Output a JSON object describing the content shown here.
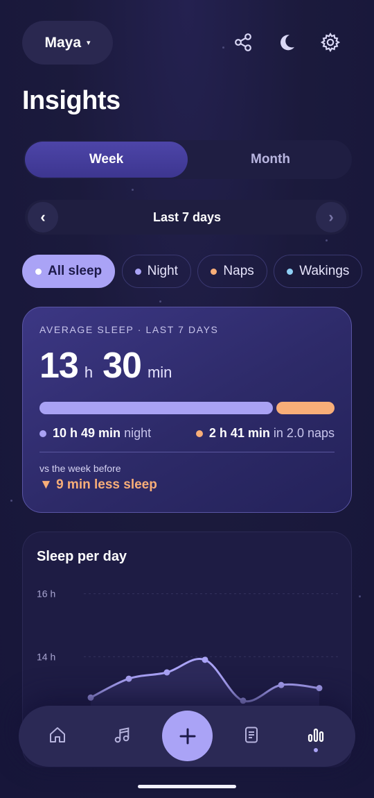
{
  "header": {
    "profile_name": "Maya",
    "profile_caret": "▾",
    "icons": [
      "share-icon",
      "moon-icon",
      "gear-icon"
    ]
  },
  "page": {
    "title": "Insights"
  },
  "range_tabs": [
    {
      "label": "Week",
      "active": true
    },
    {
      "label": "Month",
      "active": false
    }
  ],
  "date_nav": {
    "prev": "‹",
    "label": "Last 7 days",
    "next": "›"
  },
  "filters": [
    {
      "label": "All sleep",
      "active": true,
      "dot_color": "#ffffff"
    },
    {
      "label": "Night",
      "active": false,
      "dot_color": "#aaa3f6"
    },
    {
      "label": "Naps",
      "active": false,
      "dot_color": "#f8ae78"
    },
    {
      "label": "Wakings",
      "active": false,
      "dot_color": "#8fd0f5"
    }
  ],
  "average": {
    "caption": "AVERAGE SLEEP · LAST 7 DAYS",
    "hours": "13",
    "hours_unit": "h",
    "minutes": "30",
    "minutes_unit": "min",
    "night_fraction": 0.8,
    "night_value": "10 h 49 min",
    "night_label": "night",
    "naps_value": "2 h 41 min",
    "naps_label": "in 2.0 naps",
    "vs_label": "vs the week before",
    "vs_change": "▼ 9 min less sleep",
    "colors": {
      "night": "#a9a2f4",
      "naps": "#f8ae78"
    }
  },
  "chart": {
    "title": "Sleep per day",
    "chart_data": {
      "type": "area",
      "y_tick_labels": [
        "16 h",
        "14 h"
      ],
      "y_ticks": [
        16,
        14
      ],
      "ylim": [
        10.5,
        16.5
      ],
      "values": [
        12.7,
        13.3,
        13.5,
        13.9,
        12.6,
        13.1,
        13.0
      ],
      "grid": true,
      "series_color": "#aaa3f6"
    }
  },
  "bottom_nav": {
    "items": [
      "home-icon",
      "music-icon",
      "add-icon",
      "document-icon",
      "stats-icon"
    ],
    "active": "stats-icon"
  }
}
